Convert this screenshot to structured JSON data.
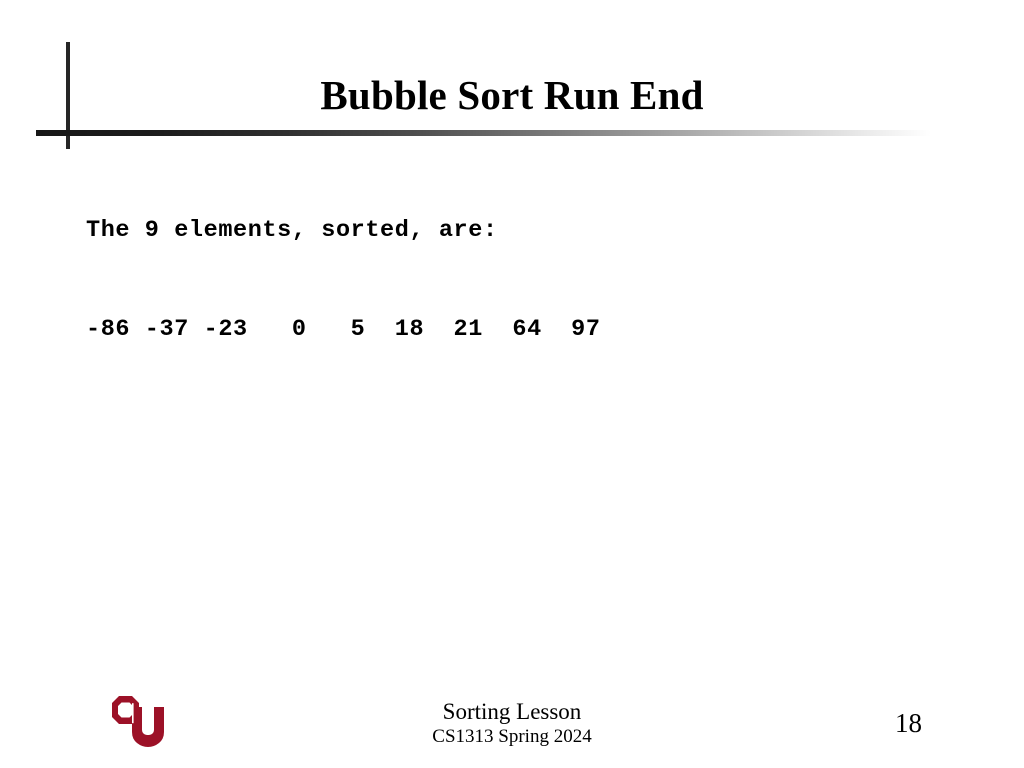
{
  "slide": {
    "title": "Bubble Sort Run End",
    "body_lines": [
      "The 9 elements, sorted, are:",
      "-86 -37 -23   0   5  18  21  64  97"
    ],
    "element_count": 9,
    "sorted_values": [
      -86,
      -37,
      -23,
      0,
      5,
      18,
      21,
      64,
      97
    ]
  },
  "footer": {
    "lesson": "Sorting Lesson",
    "course": "CS1313 Spring 2024",
    "page_number": "18",
    "logo_name": "ou-logo",
    "logo_color": "#9C1127"
  },
  "colors": {
    "background": "#FFFFFF",
    "text": "#000000",
    "rule_dark": "#171717",
    "crimson": "#9C1127"
  }
}
